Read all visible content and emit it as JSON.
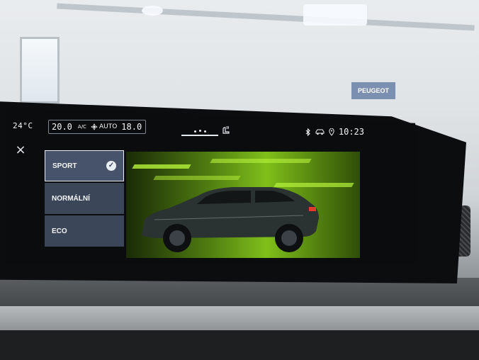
{
  "colors": {
    "screen_bg": "#0b0c0e",
    "mode_bg": "#3b4658",
    "mode_selected_bg": "#46536a",
    "accent_green": "#7fbf1a",
    "text": "#f2f4f6"
  },
  "status_bar": {
    "outside_temp": "24°C",
    "climate": {
      "driver_temp": "20.0",
      "ac_label": "A/C",
      "mode_label": "AUTO",
      "passenger_temp": "18.0",
      "fan_icon": "fan-icon"
    },
    "icons": [
      "bluetooth-icon",
      "car-icon",
      "location-icon"
    ],
    "clock": "10:23"
  },
  "close": {
    "label": "×",
    "icon": "close-icon"
  },
  "drive_modes": {
    "selected": "SPORT",
    "items": [
      {
        "label": "SPORT",
        "selected": true
      },
      {
        "label": "NORMÁLNÍ",
        "selected": false
      },
      {
        "label": "ECO",
        "selected": false
      }
    ]
  },
  "background_sign": {
    "text": "PEUGEOT"
  }
}
